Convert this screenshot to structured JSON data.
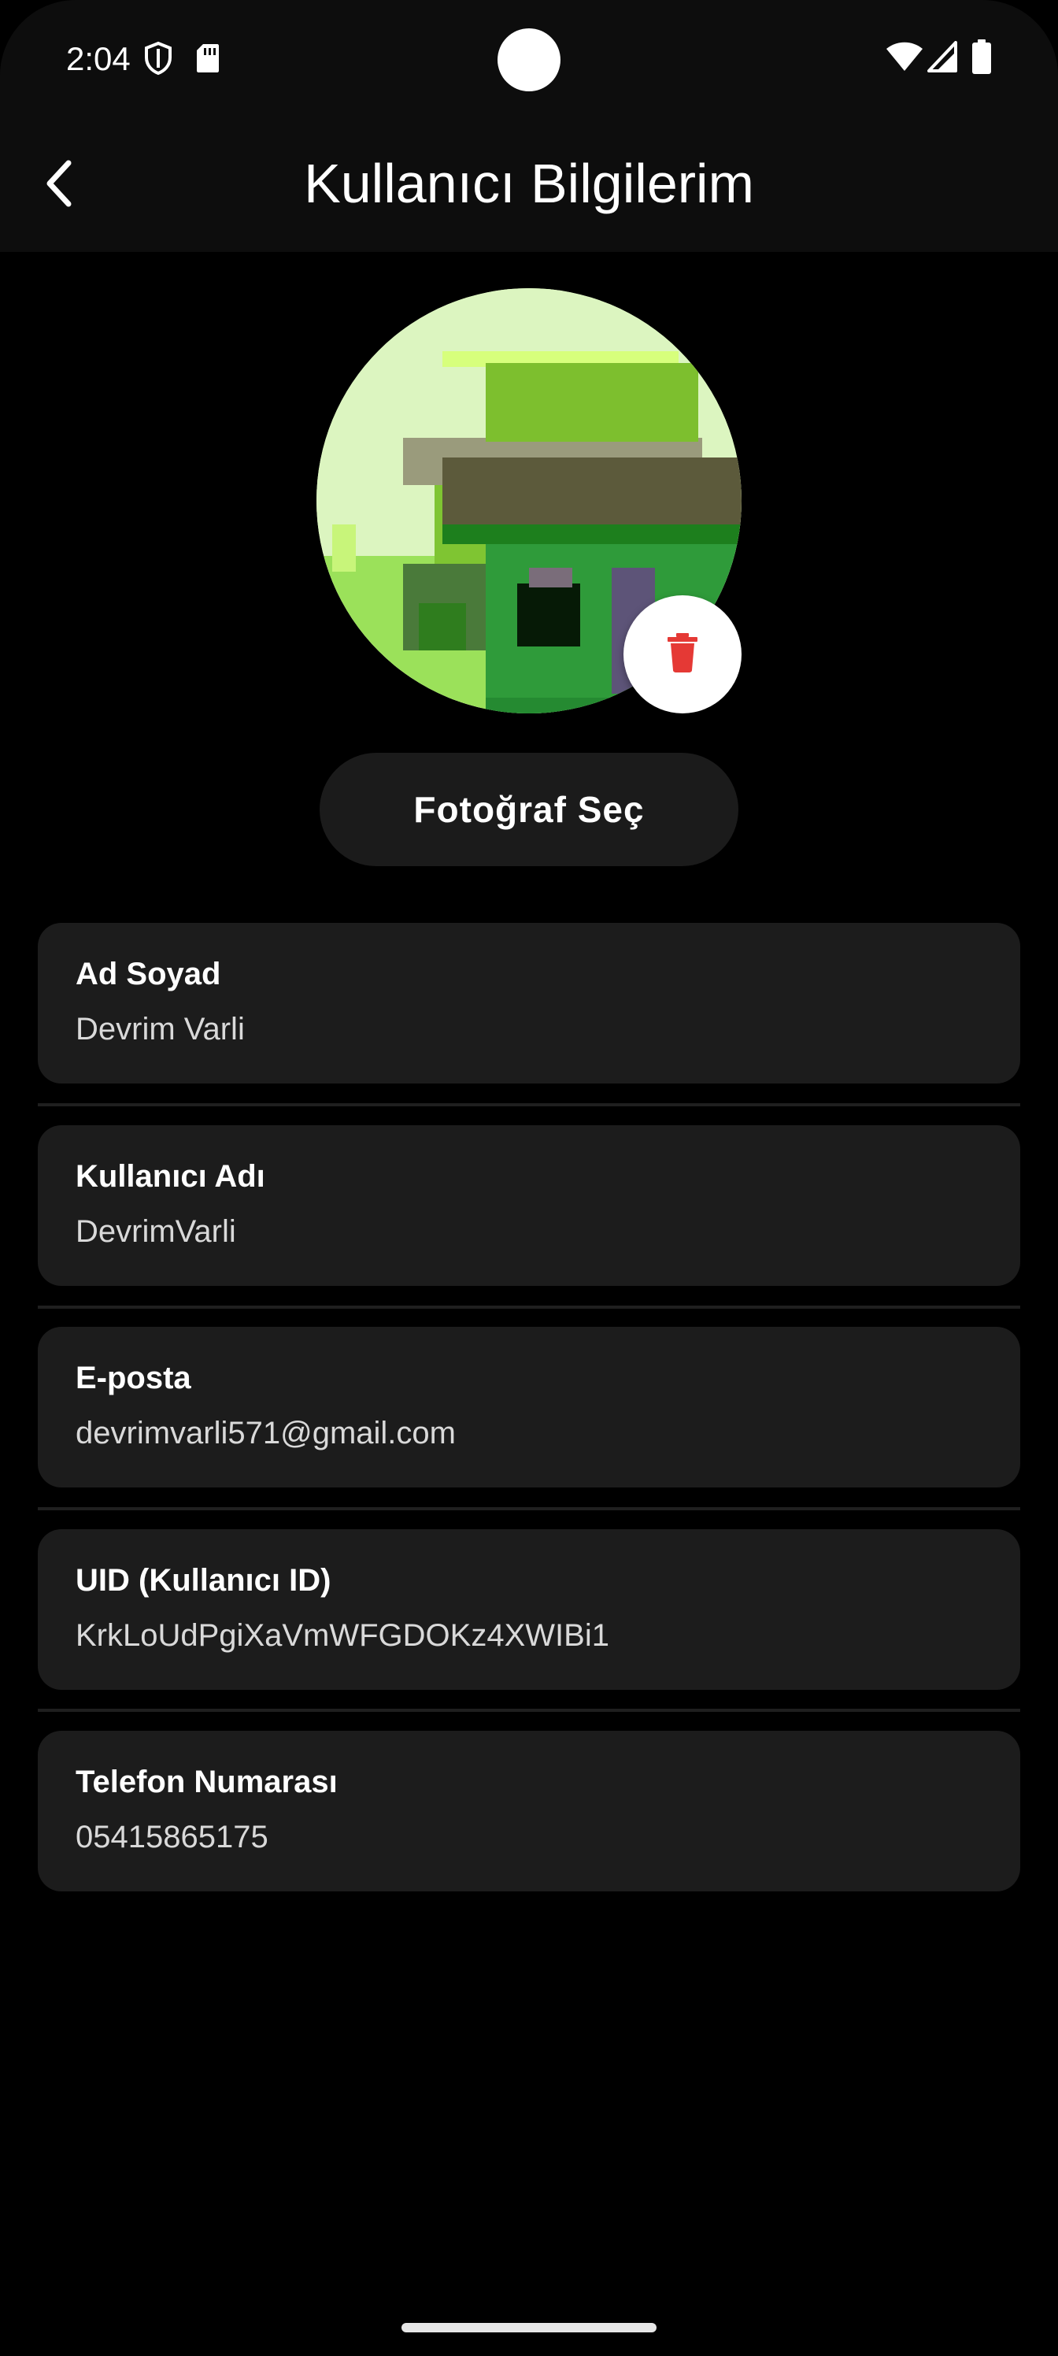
{
  "status_bar": {
    "time": "2:04",
    "icons": [
      "shield-icon",
      "sd-card-icon",
      "wifi-icon",
      "signal-icon",
      "battery-icon"
    ]
  },
  "app_bar": {
    "title": "Kullanıcı Bilgilerim",
    "back_icon": "chevron-left-icon"
  },
  "profile": {
    "delete_icon": "trash-icon",
    "delete_color": "#e53935",
    "pick_photo_label": "Fotoğraf Seç"
  },
  "fields": [
    {
      "label": "Ad Soyad",
      "value": "Devrim Varli"
    },
    {
      "label": "Kullanıcı Adı",
      "value": "DevrimVarli"
    },
    {
      "label": "E-posta",
      "value": "devrimvarli571@gmail.com"
    },
    {
      "label": "UID (Kullanıcı ID)",
      "value": "KrkLoUdPgiXaVmWFGDOKz4XWIBi1"
    },
    {
      "label": "Telefon Numarası",
      "value": "05415865175"
    }
  ],
  "colors": {
    "background": "#000000",
    "card": "#1c1c1c",
    "text": "#ffffff"
  }
}
